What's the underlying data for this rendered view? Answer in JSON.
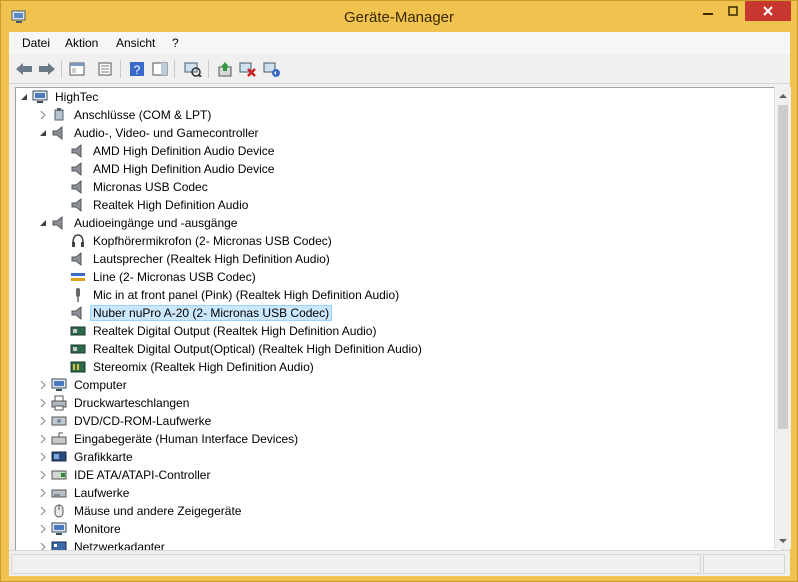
{
  "window": {
    "title": "Geräte-Manager"
  },
  "menu": [
    "Datei",
    "Aktion",
    "Ansicht",
    "?"
  ],
  "toolbar": [
    "back-icon",
    "forward-icon",
    "tree-view-icon",
    "properties-icon",
    "help-icon",
    "action-pane-icon",
    "scan-hardware-icon",
    "update-driver-icon",
    "disable-device-icon",
    "uninstall-device-icon"
  ],
  "tree": {
    "root": "HighTec",
    "nodes": [
      "Anschlüsse (COM & LPT)",
      "Audio-, Video- und Gamecontroller",
      "AMD High Definition Audio Device",
      "AMD High Definition Audio Device",
      "Micronas USB Codec",
      "Realtek High Definition Audio",
      "Audioeingänge und -ausgänge",
      "Kopfhörermikrofon (2- Micronas USB Codec)",
      "Lautsprecher (Realtek High Definition Audio)",
      "Line (2- Micronas USB Codec)",
      "Mic in at front panel (Pink) (Realtek High Definition Audio)",
      "Nuber nuPro A-20 (2- Micronas USB Codec)",
      "Realtek Digital Output (Realtek High Definition Audio)",
      "Realtek Digital Output(Optical) (Realtek High Definition Audio)",
      "Stereomix (Realtek High Definition Audio)",
      "Computer",
      "Druckwarteschlangen",
      "DVD/CD-ROM-Laufwerke",
      "Eingabegeräte (Human Interface Devices)",
      "Grafikkarte",
      "IDE ATA/ATAPI-Controller",
      "Laufwerke",
      "Mäuse und andere Zeigegeräte",
      "Monitore",
      "Netzwerkadapter"
    ]
  },
  "colors": {
    "title_bar": "#f0c24e",
    "close_button": "#c7372f",
    "selection": "#cce8ff"
  }
}
